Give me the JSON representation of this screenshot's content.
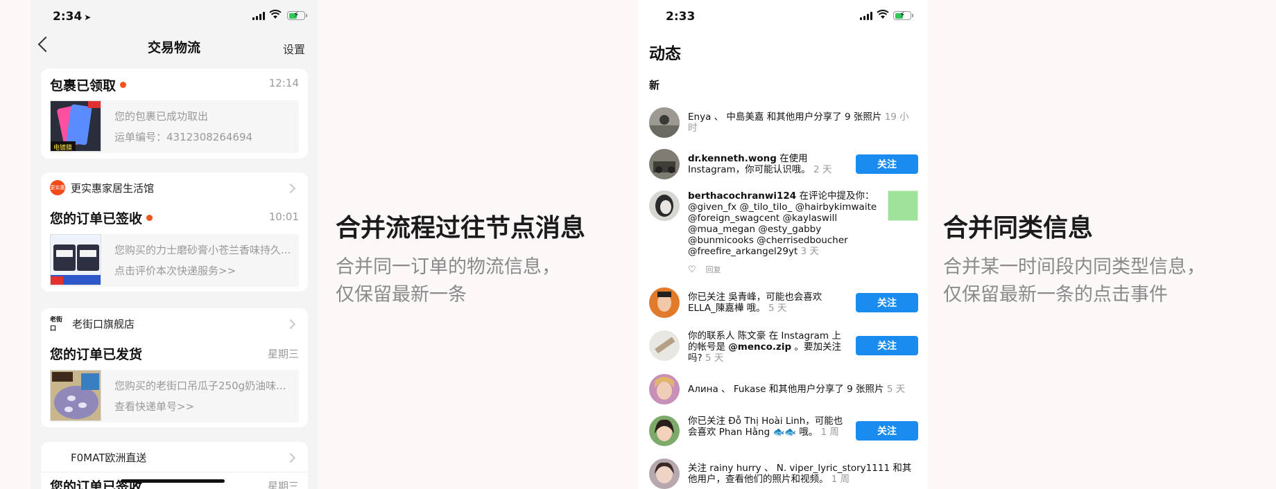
{
  "left_phone": {
    "time": "2:34",
    "nav_title": "交易物流",
    "settings": "设置",
    "cards": [
      {
        "shop": "",
        "title": "包裹已领取",
        "time": "12:14",
        "line1": "您的包裹已成功取出",
        "line2": "运单编号：4312308264694"
      },
      {
        "shop": "更实惠家居生活馆",
        "logo_text": "更实惠",
        "title": "您的订单已签收",
        "time": "10:01",
        "line1": "您购买的力士磨砂膏小苍兰香味持久...",
        "line2": "点击评价本次快递服务>>"
      },
      {
        "shop": "老街口旗舰店",
        "logo_text": "老街口",
        "title": "您的订单已发货",
        "time": "星期三",
        "line1": "您购买的老街口吊瓜子250g奶油味...",
        "line2": "查看快递单号>>"
      },
      {
        "shop": "F0MAT欧洲直送",
        "title": "您的订单已签收",
        "time": "星期三"
      }
    ]
  },
  "caption_left": {
    "heading": "合并流程过往节点消息",
    "sub1": "合并同一订单的物流信息，",
    "sub2": "仅保留最新一条"
  },
  "caption_right": {
    "heading": "合并同类信息",
    "sub1": "合并某一时间段内同类型信息，",
    "sub2": "仅保留最新一条的点击事件"
  },
  "right_phone": {
    "time": "2:33",
    "page_title": "动态",
    "section": "新",
    "follow_label": "关注",
    "reply_label": "回复",
    "rows": [
      {
        "text": "Enya 、 中島美嘉 和其他用户分享了 9 张照片",
        "time": "19 小时"
      },
      {
        "user": "dr.kenneth.wong",
        "text": " 在使用 Instagram，你可能认识哦。",
        "time": "2 天"
      },
      {
        "user": "berthacochranwi124",
        "text": " 在评论中提及你：",
        "l2": "@given_fx @_tilo_tilo_ @hairbykimwaite",
        "l3": "@foreign_swagcent @kaylaswill",
        "l4": "@mua_megan @esty_gabby",
        "l5": "@bunmicooks @cherrisedboucher",
        "l6": "@freefire_arkangel29yt",
        "time": "3 天"
      },
      {
        "text": "你已关注 吳青峰，可能也会喜欢 ELLA_陳嘉樺 哦。",
        "time": "5 天"
      },
      {
        "text": "你的联系人 陈文豪 在 Instagram 上的帐号是 ",
        "user": "@menco.zip",
        "text2": " 。要加关注吗?",
        "time": "5 天"
      },
      {
        "text": "Алина 、 Fukase 和其他用户分享了 9 张照片",
        "time": "5 天"
      },
      {
        "text": "你已关注 Đỗ Thị Hoài Linh，可能也会喜欢 Phan Hằng 🐟🐟 哦。",
        "time": "1 周"
      },
      {
        "text": "关注 rainy hurry 、 N. viper_lyric_story1111 和其他用户，查看他们的照片和视频。",
        "time": "1 周"
      }
    ]
  }
}
